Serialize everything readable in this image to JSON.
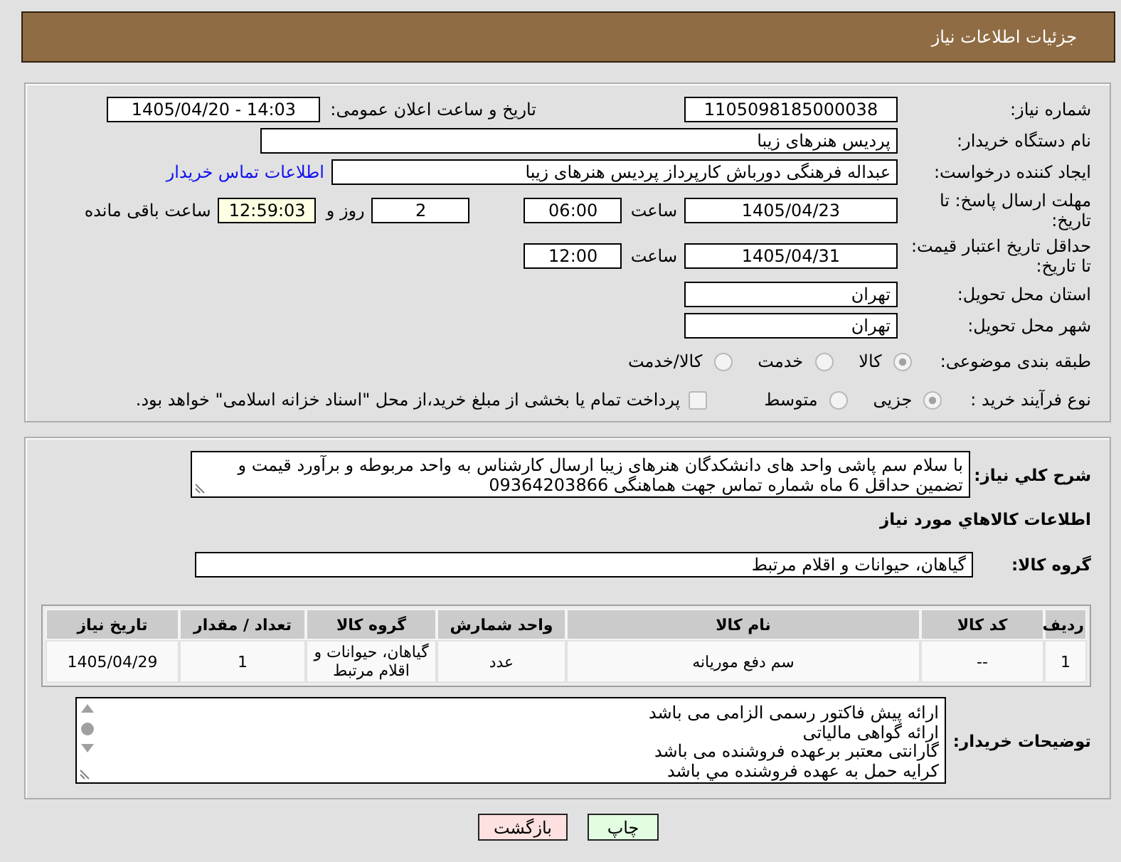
{
  "header": {
    "title": "جزئیات اطلاعات نیاز"
  },
  "details": {
    "need_number": {
      "label": "شماره نیاز:",
      "value": "1105098185000038"
    },
    "announcement": {
      "label": "تاریخ و ساعت اعلان عمومی:",
      "value": "1405/04/20 - 14:03"
    },
    "buyer_org": {
      "label": "نام دستگاه خریدار:",
      "value": "پردیس هنرهای زیبا"
    },
    "requester": {
      "label": "ایجاد کننده درخواست:",
      "value": "عبداله فرهنگی دورباش کارپرداز پردیس هنرهای زیبا",
      "link": "اطلاعات تماس خریدار"
    },
    "response_deadline": {
      "label": "مهلت ارسال پاسخ: تا تاریخ:",
      "date": "1405/04/23",
      "time_label": "ساعت",
      "time": "06:00",
      "days": "2",
      "days_label": "روز و",
      "remaining": "12:59:03",
      "remaining_label": "ساعت باقی مانده"
    },
    "price_validity": {
      "label": "حداقل تاریخ اعتبار قیمت: تا تاریخ:",
      "date": "1405/04/31",
      "time_label": "ساعت",
      "time": "12:00"
    },
    "delivery_province": {
      "label": "استان محل تحویل:",
      "value": "تهران"
    },
    "delivery_city": {
      "label": "شهر محل تحویل:",
      "value": "تهران"
    },
    "category": {
      "label": "طبقه بندی موضوعی:",
      "options": [
        {
          "label": "کالا",
          "selected": true
        },
        {
          "label": "خدمت",
          "selected": false
        },
        {
          "label": "کالا/خدمت",
          "selected": false
        }
      ]
    },
    "purchase_process": {
      "label": "نوع فرآیند خرید :",
      "options": [
        {
          "label": "جزیی",
          "selected": true
        },
        {
          "label": "متوسط",
          "selected": false
        }
      ],
      "treasury_option": {
        "label": "پرداخت تمام یا بخشی از مبلغ خرید،از محل \"اسناد خزانه اسلامی\" خواهد بود.",
        "checked": false
      }
    }
  },
  "requirements": {
    "description": {
      "label": "شرح کلي نیاز:",
      "value": "با سلام سم پاشی واحد های دانشکدگان هنرهای زیبا ارسال کارشناس به واحد مربوطه و برآورد قیمت و تضمین حداقل 6 ماه شماره تماس جهت هماهنگی 09364203866"
    },
    "goods_heading": "اطلاعات کالاهاي مورد نیاز",
    "goods_group": {
      "label": "گروه کالا:",
      "value": "گیاهان، حیوانات و اقلام مرتبط"
    },
    "table": {
      "columns": [
        "ردیف",
        "کد کالا",
        "نام کالا",
        "واحد شمارش",
        "گروه کالا",
        "تعداد / مقدار",
        "تاریخ نیاز"
      ],
      "rows": [
        {
          "cells": [
            "1",
            "--",
            "سم دفع موریانه",
            "عدد",
            "گیاهان، حیوانات و اقلام مرتبط",
            "1",
            "1405/04/29"
          ]
        }
      ]
    },
    "buyer_notes": {
      "label": "توضیحات خریدار:",
      "lines": [
        "ارائه پیش فاکتور رسمی الزامی می باشد",
        "ارائه گواهی مالیاتی",
        "گارانتی معتبر برعهده فروشنده می باشد",
        "کرایه حمل به عهده فروشنده مي باشد"
      ]
    }
  },
  "buttons": [
    {
      "label": "چاپ",
      "kind": "print"
    },
    {
      "label": "بازگشت",
      "kind": "back"
    }
  ]
}
